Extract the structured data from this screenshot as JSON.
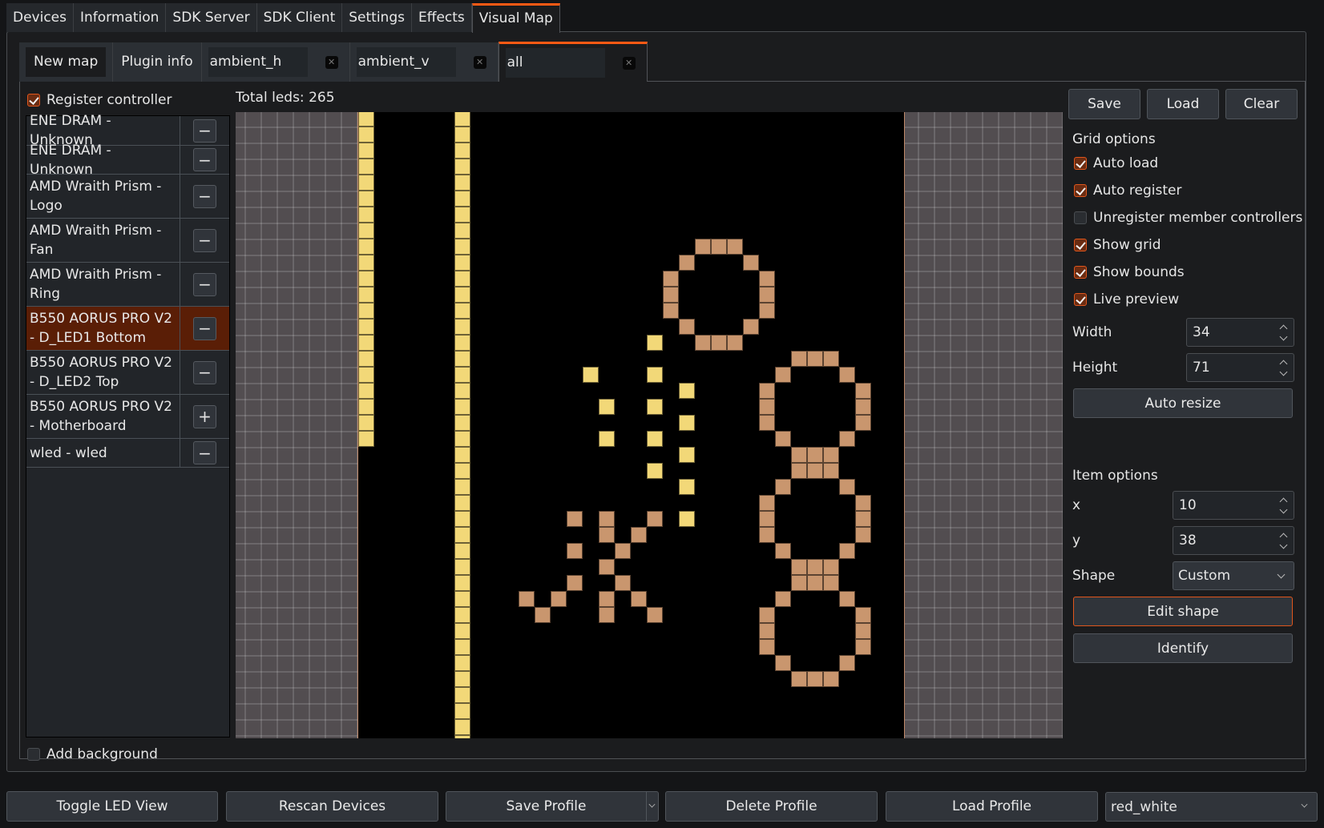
{
  "top_tabs": [
    {
      "label": "Devices",
      "active": false
    },
    {
      "label": "Information",
      "active": false
    },
    {
      "label": "SDK Server",
      "active": false
    },
    {
      "label": "SDK Client",
      "active": false
    },
    {
      "label": "Settings",
      "active": false
    },
    {
      "label": "Effects",
      "active": false
    },
    {
      "label": "Visual Map",
      "active": true
    }
  ],
  "map_tabs": {
    "new_map": "New map",
    "plugin_info": "Plugin info",
    "maps": [
      {
        "name": "ambient_h",
        "active": false
      },
      {
        "name": "ambient_v",
        "active": false
      },
      {
        "name": "all",
        "active": true
      }
    ],
    "close_glyph": "✕"
  },
  "left": {
    "register_controller": {
      "label": "Register controller",
      "checked": true
    },
    "devices": [
      {
        "name": "ENE DRAM - Unknown",
        "action": "−",
        "selected": false
      },
      {
        "name": "ENE DRAM - Unknown",
        "action": "−",
        "selected": false
      },
      {
        "name": "AMD Wraith Prism - Logo",
        "action": "−",
        "selected": false
      },
      {
        "name": "AMD Wraith Prism - Fan",
        "action": "−",
        "selected": false
      },
      {
        "name": "AMD Wraith Prism - Ring",
        "action": "−",
        "selected": false
      },
      {
        "name": "B550 AORUS PRO V2 - D_LED1 Bottom",
        "action": "−",
        "selected": true
      },
      {
        "name": "B550 AORUS PRO V2 - D_LED2 Top",
        "action": "−",
        "selected": false
      },
      {
        "name": "B550 AORUS PRO V2 - Motherboard",
        "action": "+",
        "selected": false
      },
      {
        "name": "wled - wled",
        "action": "−",
        "selected": false
      }
    ],
    "add_background": {
      "label": "Add background",
      "checked": false
    }
  },
  "canvas": {
    "total_leds_label": "Total leds: 265",
    "colors": {
      "selected": "#f2d878",
      "other": "#c9966e"
    },
    "strips": [
      {
        "col": 0,
        "row_start": 0,
        "row_end": 20,
        "group": "selected"
      },
      {
        "col": 6,
        "row_start": 0,
        "row_end": 39,
        "group": "selected"
      }
    ],
    "cells": {
      "selected": [
        [
          18,
          14
        ],
        [
          18,
          16
        ],
        [
          18,
          18
        ],
        [
          18,
          20
        ],
        [
          18,
          22
        ],
        [
          14,
          16
        ],
        [
          15,
          18
        ],
        [
          15,
          20
        ],
        [
          20,
          17
        ],
        [
          20,
          19
        ],
        [
          20,
          21
        ],
        [
          20,
          23
        ],
        [
          20,
          25
        ]
      ],
      "other": [
        [
          13,
          25
        ],
        [
          15,
          25
        ],
        [
          18,
          25
        ],
        [
          15,
          26
        ],
        [
          17,
          26
        ],
        [
          13,
          27
        ],
        [
          16,
          27
        ],
        [
          15,
          28
        ],
        [
          13,
          29
        ],
        [
          16,
          29
        ],
        [
          10,
          30
        ],
        [
          12,
          30
        ],
        [
          15,
          30
        ],
        [
          17,
          30
        ],
        [
          11,
          31
        ],
        [
          15,
          31
        ],
        [
          18,
          31
        ]
      ]
    },
    "rings": [
      {
        "col": 19,
        "row": 8,
        "group": "other"
      },
      {
        "col": 25,
        "row": 15,
        "group": "other"
      },
      {
        "col": 25,
        "row": 22,
        "group": "other"
      },
      {
        "col": 25,
        "row": 29,
        "group": "other"
      }
    ],
    "ring_pattern": [
      [
        2,
        0
      ],
      [
        3,
        0
      ],
      [
        4,
        0
      ],
      [
        1,
        1
      ],
      [
        5,
        1
      ],
      [
        0,
        2
      ],
      [
        6,
        2
      ],
      [
        0,
        3
      ],
      [
        6,
        3
      ],
      [
        0,
        4
      ],
      [
        6,
        4
      ],
      [
        1,
        5
      ],
      [
        5,
        5
      ],
      [
        2,
        6
      ],
      [
        3,
        6
      ],
      [
        4,
        6
      ]
    ]
  },
  "right": {
    "save": "Save",
    "load": "Load",
    "clear": "Clear",
    "grid_options_title": "Grid options",
    "grid_options": [
      {
        "label": "Auto load",
        "checked": true
      },
      {
        "label": "Auto register",
        "checked": true
      },
      {
        "label": "Unregister member controllers",
        "checked": false
      },
      {
        "label": "Show grid",
        "checked": true
      },
      {
        "label": "Show bounds",
        "checked": true
      },
      {
        "label": "Live preview",
        "checked": true
      }
    ],
    "width_label": "Width",
    "width_value": "34",
    "height_label": "Height",
    "height_value": "71",
    "auto_resize": "Auto resize",
    "item_options_title": "Item options",
    "x_label": "x",
    "x_value": "10",
    "y_label": "y",
    "y_value": "38",
    "shape_label": "Shape",
    "shape_value": "Custom",
    "edit_shape": "Edit shape",
    "identify": "Identify"
  },
  "bottom": {
    "toggle_led_view": "Toggle LED View",
    "rescan_devices": "Rescan Devices",
    "save_profile": "Save Profile",
    "delete_profile": "Delete Profile",
    "load_profile": "Load Profile",
    "profile_value": "red_white"
  },
  "accent_color": "#ff5a14"
}
